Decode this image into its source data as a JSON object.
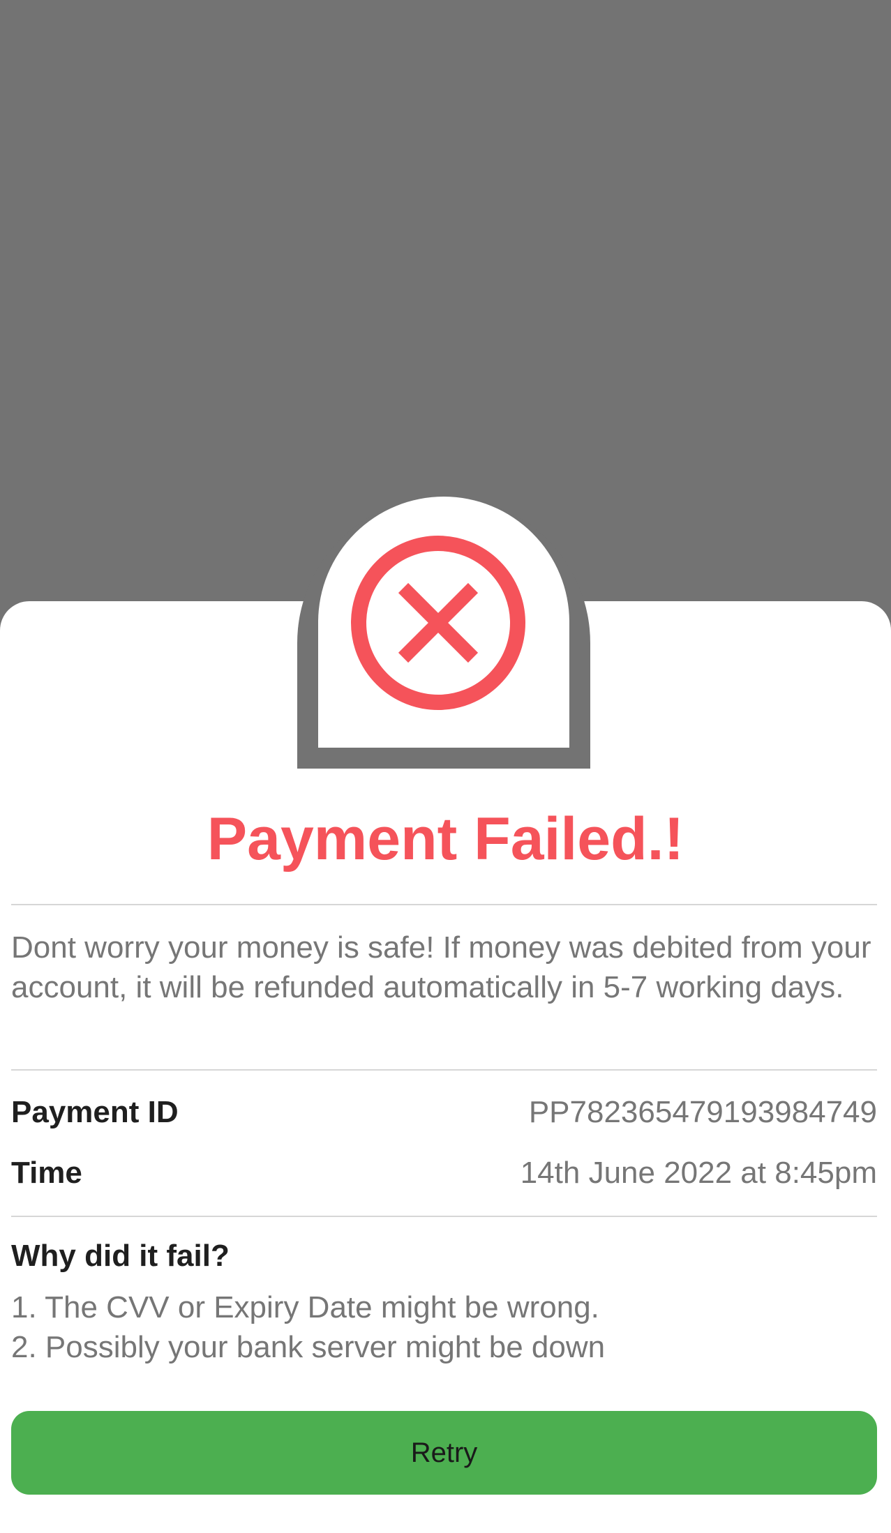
{
  "status": {
    "title": "Payment Failed.!",
    "icon": "close-circle-icon",
    "accent_color": "#F5535A"
  },
  "info_message": "Dont worry your money is safe! If money was debited from your account, it will be refunded automatically in 5-7 working days.",
  "details": [
    {
      "label": "Payment ID",
      "value": "PP782365479193984749"
    },
    {
      "label": "Time",
      "value": "14th June 2022 at 8:45pm"
    }
  ],
  "failure_reasons": {
    "heading": "Why did it fail?",
    "items": [
      "1. The CVV or Expiry Date might be wrong.",
      "2. Possibly your bank server might be down"
    ]
  },
  "actions": {
    "retry_label": "Retry",
    "retry_color": "#4CAF50"
  }
}
